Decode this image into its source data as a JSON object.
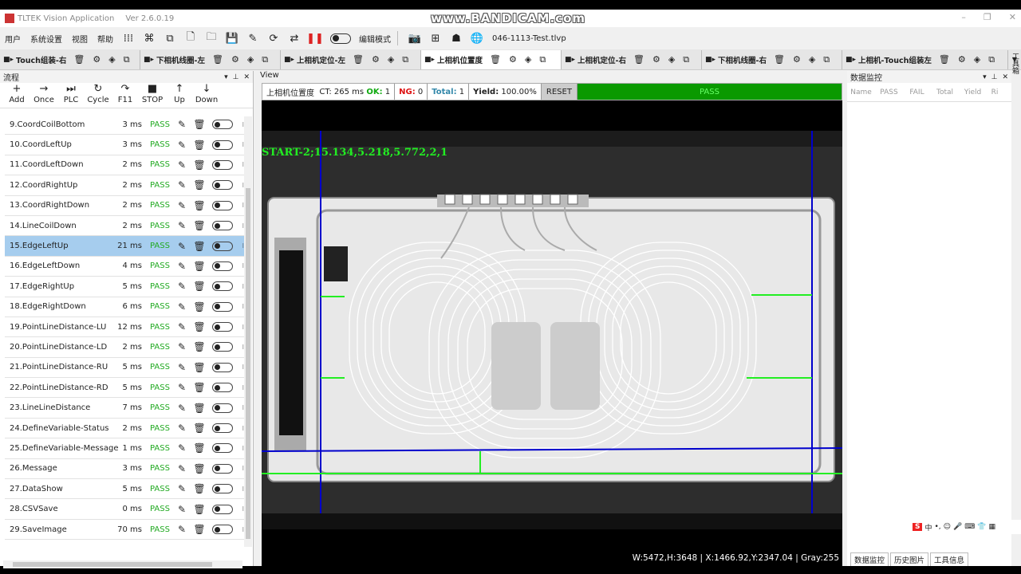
{
  "window": {
    "title": "TLTEK Vision Application",
    "version": "Ver 2.6.0.19",
    "controls": [
      "–",
      "❐",
      "✕"
    ]
  },
  "watermark": "www.BANDICAM.com",
  "menu": [
    "用户",
    "系统设置",
    "视图",
    "帮助"
  ],
  "toolbar": {
    "edit_mode_label": "编辑模式",
    "project_file": "046-1113-Test.tlvp"
  },
  "tabs": [
    {
      "label": "Touch组装-右"
    },
    {
      "label": "下相机线圈-左"
    },
    {
      "label": "上相机定位-左"
    },
    {
      "label": "上相机位置度"
    },
    {
      "label": "上相机定位-右"
    },
    {
      "label": "下相机线圈-右"
    },
    {
      "label": "上相机-Touch组装左"
    }
  ],
  "side_tab": "工具箱",
  "flow_panel": {
    "title": "流程",
    "tools": [
      {
        "icon": "+",
        "label": "Add"
      },
      {
        "icon": "→",
        "label": "Once"
      },
      {
        "icon": "⏭",
        "label": "PLC"
      },
      {
        "icon": "↻",
        "label": "Cycle"
      },
      {
        "icon": "↷",
        "label": "F11"
      },
      {
        "icon": "■",
        "label": "STOP"
      },
      {
        "icon": "↑",
        "label": "Up"
      },
      {
        "icon": "↓",
        "label": "Down"
      }
    ],
    "rows": [
      {
        "name": "9.CoordCoilBottom",
        "time": "3 ms",
        "status": "PASS"
      },
      {
        "name": "10.CoordLeftUp",
        "time": "3 ms",
        "status": "PASS"
      },
      {
        "name": "11.CoordLeftDown",
        "time": "2 ms",
        "status": "PASS"
      },
      {
        "name": "12.CoordRightUp",
        "time": "2 ms",
        "status": "PASS"
      },
      {
        "name": "13.CoordRightDown",
        "time": "2 ms",
        "status": "PASS"
      },
      {
        "name": "14.LineCoilDown",
        "time": "2 ms",
        "status": "PASS"
      },
      {
        "name": "15.EdgeLeftUp",
        "time": "21 ms",
        "status": "PASS"
      },
      {
        "name": "16.EdgeLeftDown",
        "time": "4 ms",
        "status": "PASS"
      },
      {
        "name": "17.EdgeRightUp",
        "time": "5 ms",
        "status": "PASS"
      },
      {
        "name": "18.EdgeRightDown",
        "time": "6 ms",
        "status": "PASS"
      },
      {
        "name": "19.PointLineDistance-LU",
        "time": "12 ms",
        "status": "PASS"
      },
      {
        "name": "20.PointLineDistance-LD",
        "time": "2 ms",
        "status": "PASS"
      },
      {
        "name": "21.PointLineDistance-RU",
        "time": "5 ms",
        "status": "PASS"
      },
      {
        "name": "22.PointLineDistance-RD",
        "time": "5 ms",
        "status": "PASS"
      },
      {
        "name": "23.LineLineDistance",
        "time": "7 ms",
        "status": "PASS"
      },
      {
        "name": "24.DefineVariable-Status",
        "time": "2 ms",
        "status": "PASS"
      },
      {
        "name": "25.DefineVariable-Message",
        "time": "1 ms",
        "status": "PASS"
      },
      {
        "name": "26.Message",
        "time": "3 ms",
        "status": "PASS"
      },
      {
        "name": "27.DataShow",
        "time": "5 ms",
        "status": "PASS"
      },
      {
        "name": "28.CSVSave",
        "time": "0 ms",
        "status": "PASS"
      },
      {
        "name": "29.SaveImage",
        "time": "70 ms",
        "status": "PASS"
      }
    ]
  },
  "view": {
    "label": "View",
    "station": "上相机位置度",
    "ct": "CT: 265 ms",
    "ok_label": "OK:",
    "ok": "1",
    "ng_label": "NG:",
    "ng": "0",
    "total_label": "Total:",
    "total": "1",
    "yield_label": "Yield:",
    "yield": "100.00%",
    "reset": "RESET",
    "result": "PASS",
    "overlay_text": "START-2;15.134,5.218,5.772,2,1",
    "readout": "W:5472,H:3648 | X:1466.92,Y:2347.04 | Gray:255"
  },
  "data_panel": {
    "title": "数据监控",
    "columns": [
      "Name",
      "PASS",
      "FAIL",
      "Total",
      "Yield",
      "Ri"
    ],
    "tabs": [
      "数据监控",
      "历史图片",
      "工具信息"
    ]
  },
  "ime": {
    "brand": "S",
    "items": [
      "中",
      "•,",
      "☺",
      "🎤",
      "⌨",
      "👕",
      "▦"
    ]
  },
  "colors": {
    "pass_green": "#0a9900",
    "selected_row": "#a6cdee",
    "overlay_green": "#22ee22",
    "guide_blue": "#0000cc"
  }
}
